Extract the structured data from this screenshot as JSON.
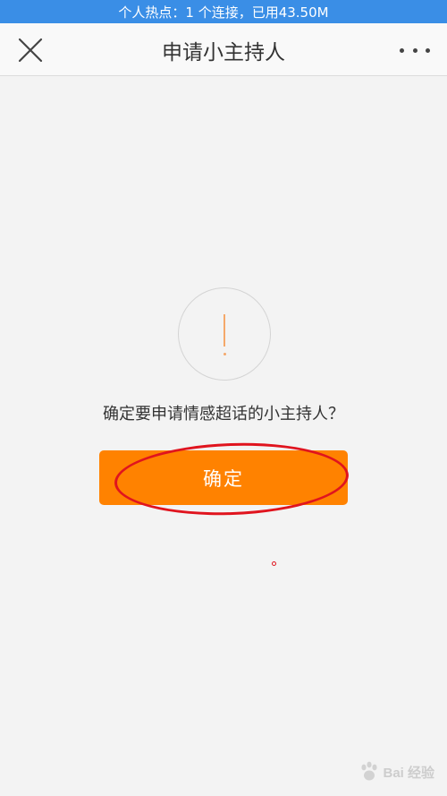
{
  "status_bar": {
    "text": "个人热点：1 个连接，已用43.50M",
    "color": "#3a8ee6"
  },
  "header": {
    "title": "申请小主持人",
    "close_icon": "close-x-icon",
    "more_icon": "more-dots-icon"
  },
  "dialog": {
    "icon": "exclamation-circle-icon",
    "question": "确定要申请情感超话的小主持人？",
    "confirm_label": "确定",
    "accent_color": "#ff8200"
  },
  "watermark": {
    "text": "Bai 经验",
    "icon": "paw-logo-icon"
  }
}
